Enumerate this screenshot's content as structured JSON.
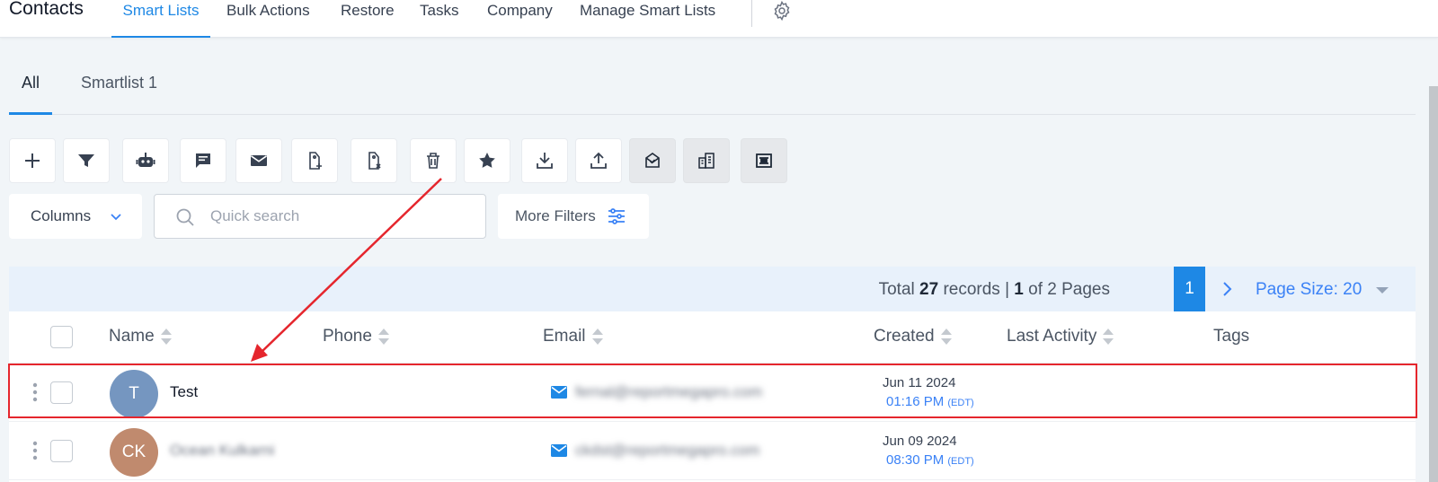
{
  "app": {
    "title": "Contacts"
  },
  "nav": {
    "items": [
      {
        "label": "Smart Lists",
        "active": true
      },
      {
        "label": "Bulk Actions"
      },
      {
        "label": "Restore"
      },
      {
        "label": "Tasks"
      },
      {
        "label": "Company"
      },
      {
        "label": "Manage Smart Lists"
      }
    ],
    "settings_icon": "gear-icon"
  },
  "tabs": [
    {
      "label": "All",
      "active": true
    },
    {
      "label": "Smartlist 1"
    }
  ],
  "toolbar": {
    "buttons": [
      {
        "icon": "add-icon"
      },
      {
        "icon": "filter-icon"
      },
      {
        "icon": "robot-icon"
      },
      {
        "icon": "message-icon"
      },
      {
        "icon": "email-icon"
      },
      {
        "icon": "add-tag-icon"
      },
      {
        "icon": "remove-tag-icon"
      },
      {
        "icon": "delete-icon"
      },
      {
        "icon": "star-icon"
      },
      {
        "icon": "download-icon"
      },
      {
        "icon": "upload-icon"
      },
      {
        "icon": "mail-review-icon"
      },
      {
        "icon": "company-building-icon"
      },
      {
        "icon": "merge-icon"
      }
    ]
  },
  "controls": {
    "columns_label": "Columns",
    "search_placeholder": "Quick search",
    "more_filters_label": "More Filters"
  },
  "pager": {
    "total_label": "Total",
    "total_count": "27",
    "records_label": "records |",
    "current_page": "1",
    "of_label": "of 2 Pages",
    "page_button": "1",
    "page_size_label": "Page Size: 20"
  },
  "table": {
    "headers": [
      "Name",
      "Phone",
      "Email",
      "Created",
      "Last Activity",
      "Tags"
    ],
    "rows": [
      {
        "initials": "T",
        "avatar_color": "#7596c0",
        "name": "Test",
        "email": "fernal@reportmegapro.com",
        "created_date": "Jun 11 2024",
        "created_time": "01:16 PM",
        "tz": "(EDT)"
      },
      {
        "initials": "CK",
        "avatar_color": "#c08a6e",
        "name": "Ocean Kulkarni",
        "email": "ckdst@reportmegapro.com",
        "created_date": "Jun 09 2024",
        "created_time": "08:30 PM",
        "tz": "(EDT)"
      }
    ]
  },
  "colors": {
    "accent": "#1e88e5",
    "annotation_red": "#e5262d"
  }
}
